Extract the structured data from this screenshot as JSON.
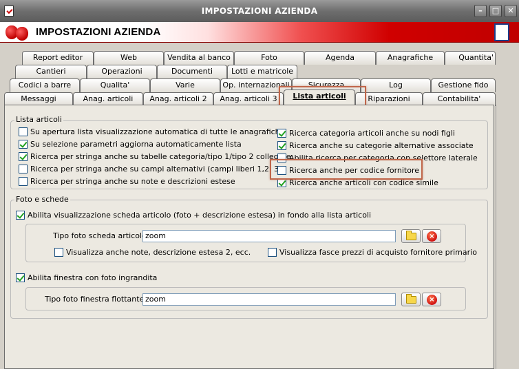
{
  "window": {
    "title": "IMPOSTAZIONI AZIENDA",
    "min_btn": "–",
    "max_btn": "□",
    "close_btn": "✕"
  },
  "header": {
    "title": "IMPOSTAZIONI AZIENDA"
  },
  "tabs": {
    "row1": [
      "Report editor",
      "Web",
      "Vendita al banco",
      "Foto",
      "Agenda",
      "Anagrafiche",
      "Quantita'"
    ],
    "row2": [
      "Cantieri",
      "Operazioni",
      "Documenti",
      "Lotti e matricole"
    ],
    "row3": [
      "Codici a barre",
      "Qualita'",
      "Varie",
      "Op. internazionali",
      "Sicurezza",
      "Log",
      "Gestione fido"
    ],
    "row4": [
      "Messaggi",
      "Anag. articoli",
      "Anag. articoli 2",
      "Anag. articoli 3",
      "Lista articoli",
      "Riparazioni",
      "Contabilita'"
    ]
  },
  "lista": {
    "title": "Lista articoli",
    "left": [
      {
        "label": "Su apertura lista visualizzazione automatica di tutte le anagrafiche",
        "checked": false
      },
      {
        "label": "Su selezione parametri aggiorna automaticamente lista",
        "checked": true
      },
      {
        "label": "Ricerca per stringa anche su tabelle categoria/tipo 1/tipo 2 collegate",
        "checked": true
      },
      {
        "label": "Ricerca per stringa anche su campi alternativi (campi liberi 1,2, 3)",
        "checked": false
      },
      {
        "label": "Ricerca per stringa anche su note e descrizioni estese",
        "checked": false
      }
    ],
    "right": [
      {
        "label": "Ricerca categoria articoli anche su nodi figli",
        "checked": true
      },
      {
        "label": "Ricerca anche su categorie alternative associate",
        "checked": true
      },
      {
        "label": "Abilita ricerca per categoria con selettore laterale",
        "checked": false
      },
      {
        "label": "Ricerca anche per codice fornitore",
        "checked": false
      },
      {
        "label": "Ricerca anche articoli con codice simile",
        "checked": true
      }
    ]
  },
  "foto": {
    "title": "Foto e schede",
    "abilita_scheda": {
      "label": "Abilita visualizzazione scheda articolo (foto + descrizione estesa) in fondo alla lista articoli",
      "checked": true
    },
    "tipo_foto_scheda": {
      "label": "Tipo foto scheda articolo :",
      "value": "zoom"
    },
    "visualizza_note": {
      "label": "Visualizza anche note, descrizione estesa 2, ecc.",
      "checked": false
    },
    "visualizza_fasce": {
      "label": "Visualizza fasce prezzi di acquisto fornitore primario",
      "checked": false
    },
    "abilita_finestra": {
      "label": "Abilita finestra con foto ingrandita",
      "checked": true
    },
    "tipo_foto_finestra": {
      "label": "Tipo foto finestra flottante :",
      "value": "zoom"
    }
  },
  "icons": {
    "browse": "folder-icon",
    "clear": "delete-icon"
  },
  "colors": {
    "highlight": "#c0664a",
    "check": "#21a121",
    "header_red": "#c00000"
  }
}
